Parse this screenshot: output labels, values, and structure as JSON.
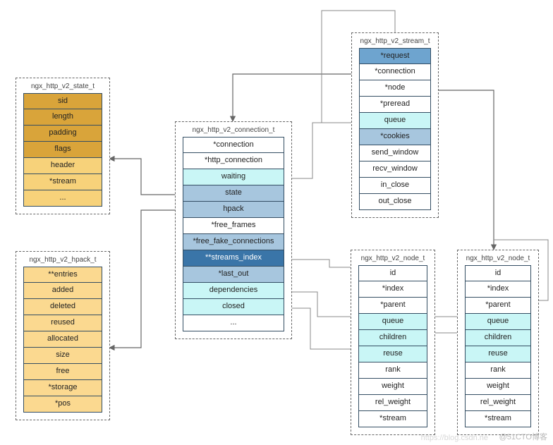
{
  "watermark_left": "https://blog.csdn.ne",
  "watermark_right": "@51CTO博客",
  "state": {
    "title": "ngx_http_v2_state_t",
    "rows": [
      {
        "label": "sid",
        "cls": "c-gold"
      },
      {
        "label": "length",
        "cls": "c-gold"
      },
      {
        "label": "padding",
        "cls": "c-gold"
      },
      {
        "label": "flags",
        "cls": "c-gold"
      },
      {
        "label": "header",
        "cls": "c-lgold"
      },
      {
        "label": "*stream",
        "cls": "c-lgold"
      },
      {
        "label": "...",
        "cls": "c-lgold"
      }
    ]
  },
  "hpack": {
    "title": "ngx_http_v2_hpack_t",
    "rows": [
      {
        "label": "**entries",
        "cls": "c-amber"
      },
      {
        "label": "added",
        "cls": "c-amber"
      },
      {
        "label": "deleted",
        "cls": "c-amber"
      },
      {
        "label": "reused",
        "cls": "c-amber"
      },
      {
        "label": "allocated",
        "cls": "c-amber"
      },
      {
        "label": "size",
        "cls": "c-amber"
      },
      {
        "label": "free",
        "cls": "c-amber"
      },
      {
        "label": "*storage",
        "cls": "c-amber"
      },
      {
        "label": "*pos",
        "cls": "c-amber"
      }
    ]
  },
  "conn": {
    "title": "ngx_http_v2_connection_t",
    "rows": [
      {
        "label": "*connection",
        "cls": "c-white"
      },
      {
        "label": "*http_connection",
        "cls": "c-white"
      },
      {
        "label": "waiting",
        "cls": "c-cyan"
      },
      {
        "label": "state",
        "cls": "c-lblue"
      },
      {
        "label": "hpack",
        "cls": "c-lblue"
      },
      {
        "label": "*free_frames",
        "cls": "c-white"
      },
      {
        "label": "*free_fake_connections",
        "cls": "c-lblue"
      },
      {
        "label": "**streams_index",
        "cls": "c-dblue"
      },
      {
        "label": "*last_out",
        "cls": "c-lblue"
      },
      {
        "label": "dependencies",
        "cls": "c-cyan"
      },
      {
        "label": "closed",
        "cls": "c-cyan"
      },
      {
        "label": "...",
        "cls": "c-white"
      }
    ]
  },
  "stream": {
    "title": "ngx_http_v2_stream_t",
    "rows": [
      {
        "label": "*request",
        "cls": "c-mblue"
      },
      {
        "label": "*connection",
        "cls": "c-white"
      },
      {
        "label": "*node",
        "cls": "c-white"
      },
      {
        "label": "*preread",
        "cls": "c-white"
      },
      {
        "label": "queue",
        "cls": "c-cyan"
      },
      {
        "label": "*cookies",
        "cls": "c-lblue"
      },
      {
        "label": "send_window",
        "cls": "c-white"
      },
      {
        "label": "recv_window",
        "cls": "c-white"
      },
      {
        "label": "in_close",
        "cls": "c-white"
      },
      {
        "label": "out_close",
        "cls": "c-white"
      }
    ]
  },
  "node1": {
    "title": "ngx_http_v2_node_t",
    "rows": [
      {
        "label": "id",
        "cls": "c-white"
      },
      {
        "label": "*index",
        "cls": "c-white"
      },
      {
        "label": "*parent",
        "cls": "c-white"
      },
      {
        "label": "queue",
        "cls": "c-cyan"
      },
      {
        "label": "children",
        "cls": "c-cyan"
      },
      {
        "label": "reuse",
        "cls": "c-cyan"
      },
      {
        "label": "rank",
        "cls": "c-white"
      },
      {
        "label": "weight",
        "cls": "c-white"
      },
      {
        "label": "rel_weight",
        "cls": "c-white"
      },
      {
        "label": "*stream",
        "cls": "c-white"
      }
    ]
  },
  "node2": {
    "title": "ngx_http_v2_node_t",
    "rows": [
      {
        "label": "id",
        "cls": "c-white"
      },
      {
        "label": "*index",
        "cls": "c-white"
      },
      {
        "label": "*parent",
        "cls": "c-white"
      },
      {
        "label": "queue",
        "cls": "c-cyan"
      },
      {
        "label": "children",
        "cls": "c-cyan"
      },
      {
        "label": "reuse",
        "cls": "c-cyan"
      },
      {
        "label": "rank",
        "cls": "c-white"
      },
      {
        "label": "weight",
        "cls": "c-white"
      },
      {
        "label": "rel_weight",
        "cls": "c-white"
      },
      {
        "label": "*stream",
        "cls": "c-white"
      }
    ]
  }
}
